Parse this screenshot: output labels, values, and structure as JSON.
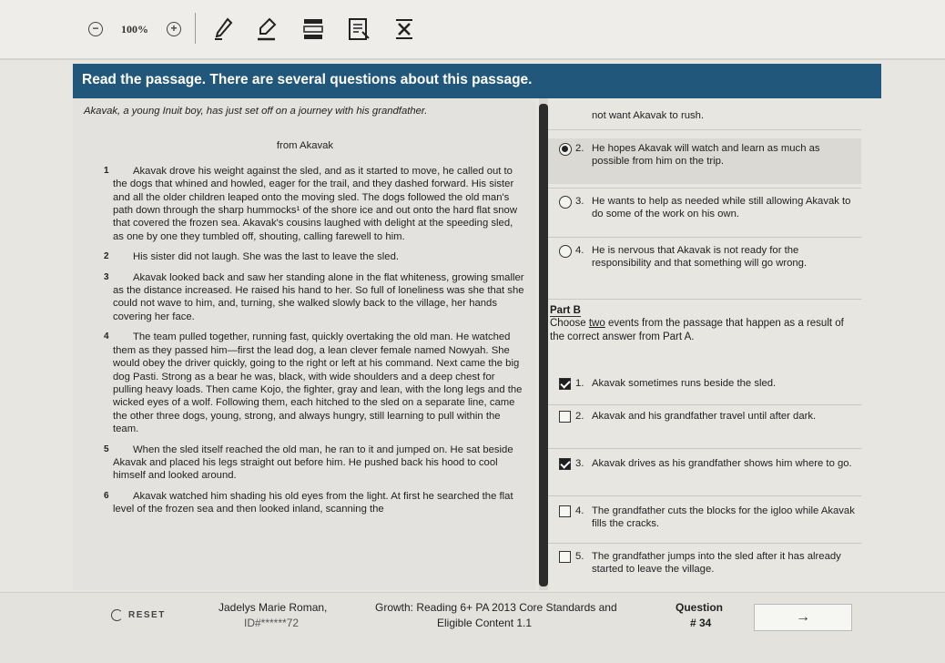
{
  "toolbar": {
    "zoom_out_icon": "minus-circle",
    "zoom_level": "100%",
    "zoom_in_icon": "plus-circle",
    "tools": [
      "pen-icon",
      "highlighter-icon",
      "line-reader-icon",
      "notepad-icon",
      "answer-eliminator-icon"
    ]
  },
  "banner": {
    "text": "Read the passage. There are several questions about this passage."
  },
  "passage": {
    "intro": "Akavak, a young Inuit boy, has just set off on a journey with his grandfather.",
    "source": "from Akavak",
    "paragraphs": [
      {
        "num": "1",
        "text": "Akavak drove his weight against the sled, and as it started to move, he called out to the dogs that whined and howled, eager for the trail, and they dashed forward. His sister and all the older children leaped onto the moving sled. The dogs followed the old man's path down through the sharp hummocks¹ of the shore ice and out onto the hard flat snow that covered the frozen sea. Akavak's cousins laughed with delight at the speeding sled, as one by one they tumbled off, shouting, calling farewell to him."
      },
      {
        "num": "2",
        "text": "His sister did not laugh. She was the last to leave the sled."
      },
      {
        "num": "3",
        "text": "Akavak looked back and saw her standing alone in the flat whiteness, growing smaller as the distance increased. He raised his hand to her. So full of loneliness was she that she could not wave to him, and, turning, she walked slowly back to the village, her hands covering her face."
      },
      {
        "num": "4",
        "text": "The team pulled together, running fast, quickly overtaking the old man. He watched them as they passed him—first the lead dog, a lean clever female named Nowyah. She would obey the driver quickly, going to the right or left at his command. Next came the big dog Pasti. Strong as a bear he was, black, with wide shoulders and a deep chest for pulling heavy loads. Then came Kojo, the fighter, gray and lean, with the long legs and the wicked eyes of a wolf. Following them, each hitched to the sled on a separate line, came the other three dogs, young, strong, and always hungry, still learning to pull within the team."
      },
      {
        "num": "5",
        "text": "When the sled itself reached the old man, he ran to it and jumped on. He sat beside Akavak and placed his legs straight out before him. He pushed back his hood to cool himself and looked around."
      },
      {
        "num": "6",
        "text": "Akavak watched him shading his old eyes from the light. At first he searched the flat level of the frozen sea and then looked inland, scanning the"
      }
    ]
  },
  "part_a": {
    "prev_option_tail": "not want Akavak to rush.",
    "options": [
      {
        "num": "2.",
        "text": "He hopes Akavak will watch and learn as much as possible from him on the trip.",
        "selected": true
      },
      {
        "num": "3.",
        "text": "He wants to help as needed while still allowing Akavak to do some of the work on his own.",
        "selected": false
      },
      {
        "num": "4.",
        "text": "He is nervous that Akavak is not ready for the responsibility and that something will go wrong.",
        "selected": false
      }
    ]
  },
  "part_b": {
    "label": "Part B",
    "prompt_a": "Choose ",
    "prompt_u": "two",
    "prompt_b": " events from the passage that happen as a result of the correct answer from Part A.",
    "options": [
      {
        "num": "1.",
        "text": "Akavak sometimes runs beside the sled.",
        "checked": true
      },
      {
        "num": "2.",
        "text": "Akavak and his grandfather travel until after dark.",
        "checked": false
      },
      {
        "num": "3.",
        "text": "Akavak drives as his grandfather shows him where to go.",
        "checked": true
      },
      {
        "num": "4.",
        "text": "The grandfather cuts the blocks for the igloo while Akavak fills the cracks.",
        "checked": false
      },
      {
        "num": "5.",
        "text": "The grandfather jumps into the sled after it has already started to leave the village.",
        "checked": false
      }
    ]
  },
  "footer": {
    "reset_label": "RESET",
    "student_name": "Jadelys Marie Roman,",
    "student_id": "ID#******72",
    "test_name": "Growth: Reading 6+ PA 2013 Core Standards and",
    "test_sub": "Eligible Content 1.1",
    "question_label": "Question",
    "question_num": "# 34",
    "next_icon": "→"
  }
}
